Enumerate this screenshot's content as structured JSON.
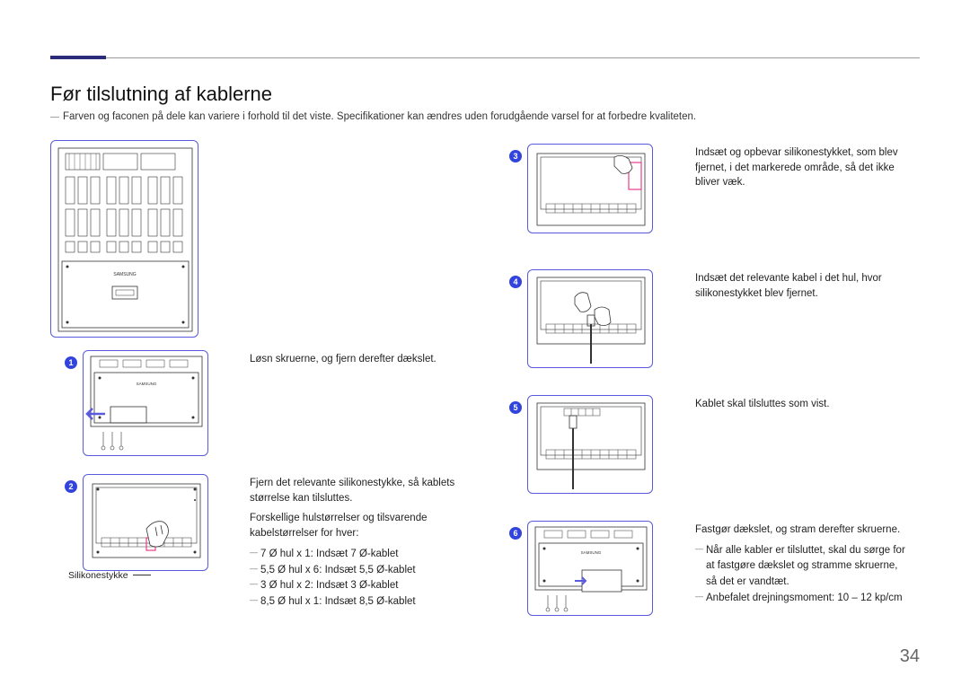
{
  "title": "Før tilslutning af kablerne",
  "subtitle": "Farven og faconen på dele kan variere i forhold til det viste. Specifikationer kan ændres uden forudgående varsel for at forbedre kvaliteten.",
  "page_number": "34",
  "callout_silicone": "Silikonestykke",
  "steps": {
    "s1": {
      "num": "1",
      "text": "Løsn skruerne, og fjern derefter dækslet."
    },
    "s2": {
      "num": "2",
      "line1": "Fjern det relevante silikonestykke, så kablets størrelse kan tilsluttes.",
      "line2": "Forskellige hulstørrelser og tilsvarende kabelstørrelser for hver:",
      "b1": "7 Ø hul x 1: Indsæt 7 Ø-kablet",
      "b2": "5,5 Ø hul x 6: Indsæt 5,5 Ø-kablet",
      "b3": "3 Ø hul x 2: Indsæt 3 Ø-kablet",
      "b4": "8,5 Ø hul x 1: Indsæt 8,5 Ø-kablet"
    },
    "s3": {
      "num": "3",
      "text": "Indsæt og opbevar silikonestykket, som blev fjernet, i det markerede område, så det ikke bliver væk."
    },
    "s4": {
      "num": "4",
      "text": "Indsæt det relevante kabel i det hul, hvor silikonestykket blev fjernet."
    },
    "s5": {
      "num": "5",
      "text": "Kablet skal tilsluttes som vist."
    },
    "s6": {
      "num": "6",
      "line1": "Fastgør dækslet, og stram derefter skruerne.",
      "b1": "Når alle kabler er tilsluttet, skal du sørge for at fastgøre dækslet og stramme skruerne, så det er vandtæt.",
      "b2": "Anbefalet drejningsmoment: 10 – 12 kp/cm"
    }
  }
}
